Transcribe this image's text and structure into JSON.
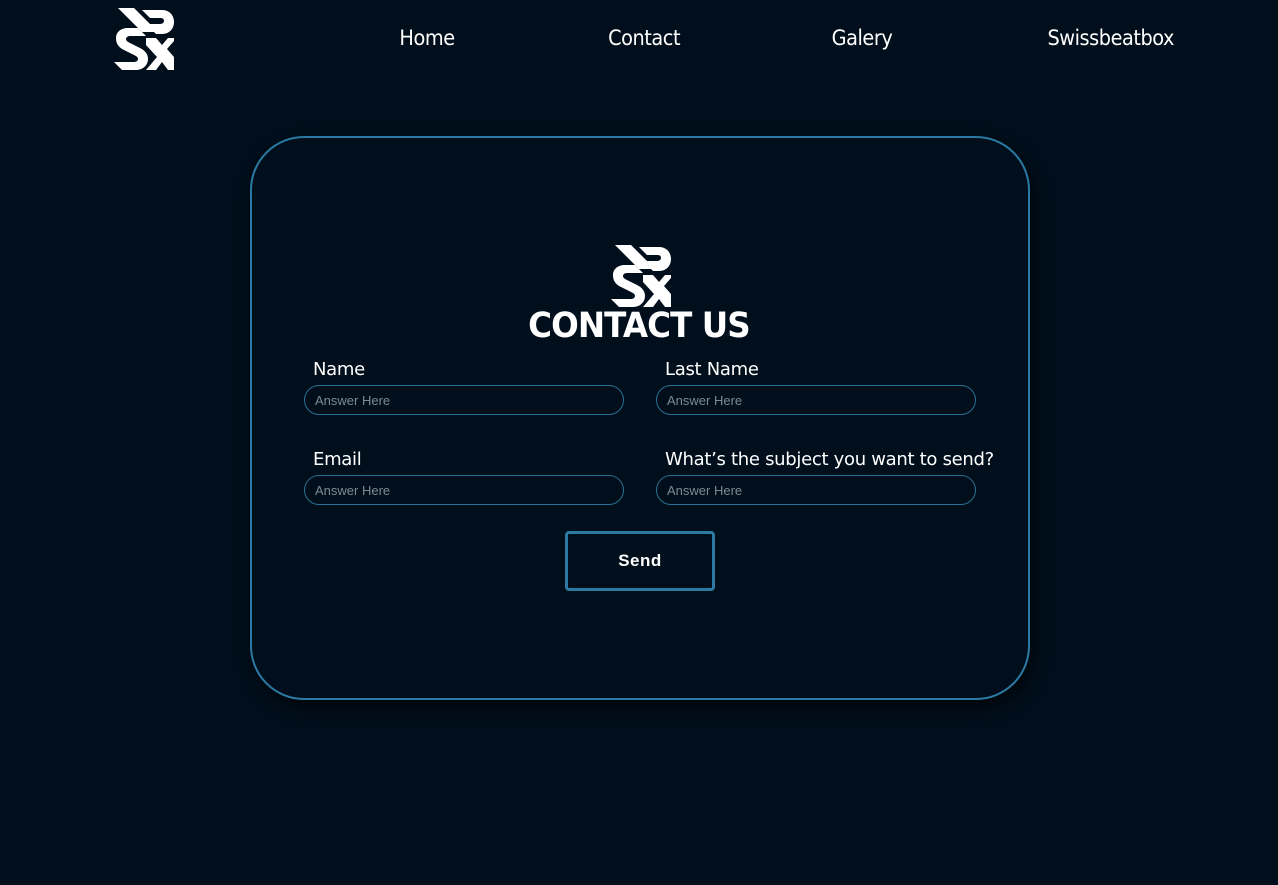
{
  "nav": {
    "logo": "sbx-logo-icon",
    "links": [
      {
        "label": "Home"
      },
      {
        "label": "Contact"
      },
      {
        "label": "Galery"
      },
      {
        "label": "Swissbeatbox"
      }
    ]
  },
  "form": {
    "logo": "sbx-logo-icon",
    "title": "CONTACT US",
    "fields": [
      {
        "label": "Name",
        "placeholder": "Answer Here",
        "value": ""
      },
      {
        "label": "Last Name",
        "placeholder": "Answer Here",
        "value": ""
      },
      {
        "label": "Email",
        "placeholder": "Answer Here",
        "value": ""
      },
      {
        "label": "What’s the subject you want to send?",
        "placeholder": "Answer Here",
        "value": ""
      }
    ],
    "submit_label": "Send"
  },
  "colors": {
    "background": "#010e1b",
    "accent": "#2a7aa3",
    "text": "#ffffff",
    "placeholder": "#7d8a95"
  }
}
